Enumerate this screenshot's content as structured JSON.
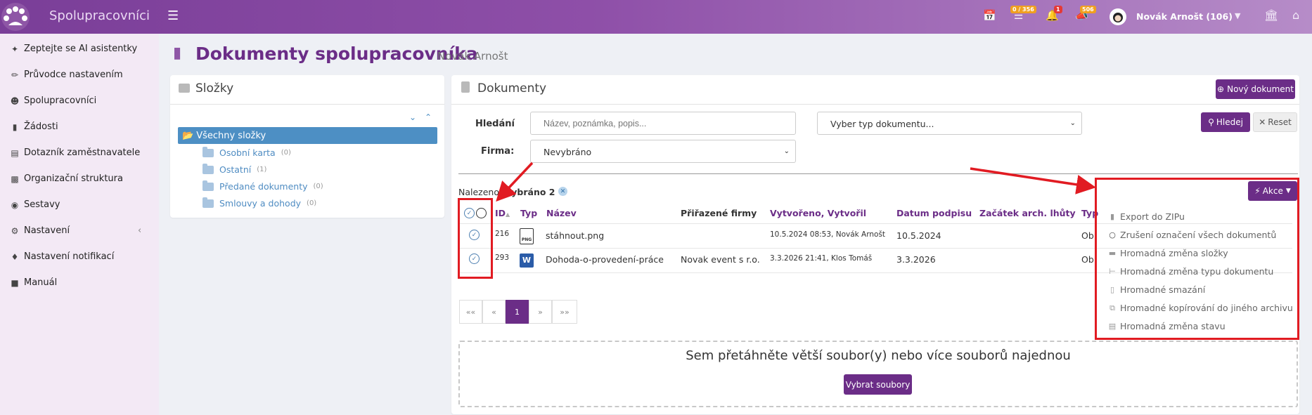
{
  "app": {
    "title": "Spolupracovníci"
  },
  "topbar": {
    "badges": [
      "0 / 356",
      "1",
      "506"
    ],
    "user_name": "Novák Arnošt (106)",
    "colors": {
      "primary": "#6b2d87",
      "badge_orange": "#f0a020",
      "badge_red": "#e53935"
    }
  },
  "sidebar": {
    "items": [
      {
        "label": "Zeptejte se AI asistentky",
        "icon": "sparkle-icon"
      },
      {
        "label": "Průvodce nastavením",
        "icon": "wand-icon"
      },
      {
        "label": "Spolupracovníci",
        "icon": "users-icon"
      },
      {
        "label": "Žádosti",
        "icon": "file-icon"
      },
      {
        "label": "Dotazník zaměstnavatele",
        "icon": "clipboard-icon"
      },
      {
        "label": "Organizační struktura",
        "icon": "org-icon"
      },
      {
        "label": "Sestavy",
        "icon": "eye-icon"
      },
      {
        "label": "Nastavení",
        "icon": "cogs-icon"
      },
      {
        "label": "Nastavení notifikací",
        "icon": "bell-icon"
      },
      {
        "label": "Manuál",
        "icon": "book-icon"
      }
    ]
  },
  "header": {
    "title": "Dokumenty spolupracovníka",
    "subtitle": "Novák Arnošt"
  },
  "folders": {
    "title": "Složky",
    "root": "Všechny složky",
    "items": [
      {
        "name": "Osobní karta",
        "count": "(0)"
      },
      {
        "name": "Ostatní",
        "count": "(1)"
      },
      {
        "name": "Předané dokumenty",
        "count": "(0)"
      },
      {
        "name": "Smlouvy a dohody",
        "count": "(0)"
      }
    ]
  },
  "documents": {
    "title": "Dokumenty",
    "new_button": "Nový dokument",
    "search_label": "Hledání",
    "search_placeholder": "Název, poznámka, popis...",
    "type_select": "Vyber typ dokumentu...",
    "company_label": "Firma:",
    "company_select": "Nevybráno",
    "search_button": "Hledej",
    "reset_button": "Reset",
    "found_prefix": "Nalezeno",
    "found_selected": ", vybráno 2",
    "actions_button": "Akce",
    "columns": [
      "ID",
      "Typ",
      "Název",
      "Přiřazené firmy",
      "Vytvořeno, Vytvořil",
      "Datum podpisu",
      "Začátek arch. lhůty",
      "Typ"
    ],
    "rows": [
      {
        "id": "216",
        "type": "png",
        "name": "stáhnout.png",
        "company": "",
        "created": "10.5.2024 08:53, Novák Arnošt",
        "signed": "10.5.2024",
        "archive": "",
        "kind": "Ob"
      },
      {
        "id": "293",
        "type": "word",
        "name": "Dohoda-o-provedení-práce",
        "company": "Novak event s r.o.",
        "created": "3.3.2026 21:41, Klos Tomáš",
        "signed": "3.3.2026",
        "archive": "",
        "kind": "Ob"
      }
    ],
    "pagination": [
      "««",
      "«",
      "1",
      "»",
      "»»"
    ],
    "drop_text": "Sem přetáhněte větší soubor(y) nebo více souborů najednou",
    "select_files": "Vybrat soubory"
  },
  "actions_menu": {
    "items": [
      {
        "label": "Export do ZIPu",
        "icon": "file-zip-icon"
      },
      {
        "label": "Zrušení označení všech dokumentů",
        "icon": "circle-icon"
      },
      {
        "label": "Hromadná změna složky",
        "icon": "folder-icon"
      },
      {
        "label": "Hromadná změna typu dokumentu",
        "icon": "tree-icon"
      },
      {
        "label": "Hromadné smazání",
        "icon": "trash-icon"
      },
      {
        "label": "Hromadné kopírování do jiného archivu",
        "icon": "copy-icon"
      },
      {
        "label": "Hromadná změna stavu",
        "icon": "archive-icon"
      }
    ]
  }
}
